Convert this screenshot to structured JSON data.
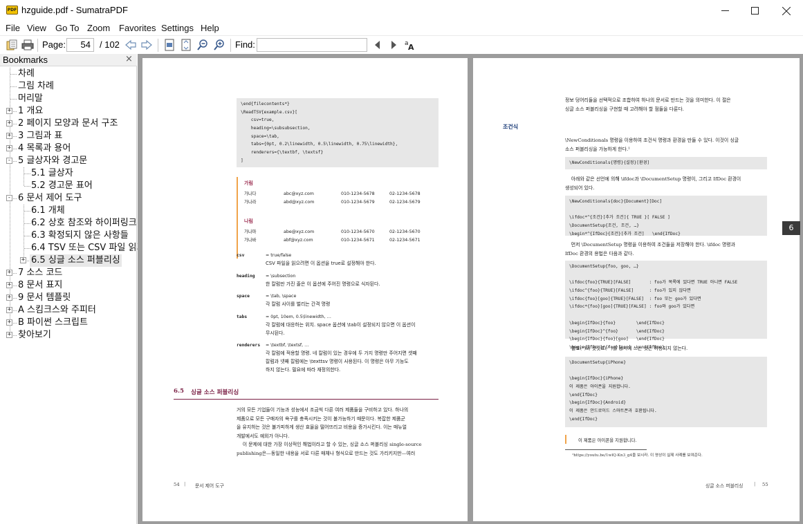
{
  "window": {
    "title": "hzguide.pdf - SumatraPDF",
    "app_icon_text": "PDF"
  },
  "menu": [
    "File",
    "View",
    "Go To",
    "Zoom",
    "Favorites",
    "Settings",
    "Help"
  ],
  "toolbar": {
    "page_label": "Page:",
    "page_value": "54",
    "page_total": "/ 102",
    "find_label": "Find:",
    "find_value": ""
  },
  "sidebar": {
    "title": "Bookmarks",
    "close": "×",
    "items": [
      {
        "label": "차례",
        "level": 0,
        "expander": ""
      },
      {
        "label": "그림 차례",
        "level": 0,
        "expander": ""
      },
      {
        "label": "머리말",
        "level": 0,
        "expander": ""
      },
      {
        "label": "1 개요",
        "level": 0,
        "expander": "+"
      },
      {
        "label": "2 페이지 모양과 문서 구조",
        "level": 0,
        "expander": "+"
      },
      {
        "label": "3 그림과 표",
        "level": 0,
        "expander": "+"
      },
      {
        "label": "4 목록과 용어",
        "level": 0,
        "expander": "+"
      },
      {
        "label": "5 글상자와 경고문",
        "level": 0,
        "expander": "-"
      },
      {
        "label": "5.1 글상자",
        "level": 1,
        "expander": ""
      },
      {
        "label": "5.2 경고문 표어",
        "level": 1,
        "expander": ""
      },
      {
        "label": "6 문서 제어 도구",
        "level": 0,
        "expander": "-"
      },
      {
        "label": "6.1 개체",
        "level": 1,
        "expander": ""
      },
      {
        "label": "6.2 상호 참조와 하이퍼링크",
        "level": 1,
        "expander": ""
      },
      {
        "label": "6.3 확정되지 않은 사항들",
        "level": 1,
        "expander": ""
      },
      {
        "label": "6.4 TSV 또는 CSV 파일 읽기",
        "level": 1,
        "expander": ""
      },
      {
        "label": "6.5 싱글 소스 퍼블리싱",
        "level": 1,
        "expander": "+"
      },
      {
        "label": "7 소스 코드",
        "level": 0,
        "expander": "+"
      },
      {
        "label": "8 문서 표지",
        "level": 0,
        "expander": "+"
      },
      {
        "label": "9 문서 템플릿",
        "level": 0,
        "expander": "+"
      },
      {
        "label": "A 스킴크스와 주피터",
        "level": 0,
        "expander": "+"
      },
      {
        "label": "B 파이썬 스크립트",
        "level": 0,
        "expander": "+"
      },
      {
        "label": "찾아보기",
        "level": 0,
        "expander": "+"
      }
    ]
  },
  "left_page": {
    "code1": [
      "\\end{filecontents*}",
      "\\ReadTSV{example.csv}[",
      "    csv=true,",
      "    heading=\\subsubsection,",
      "    space=\\tab,",
      "    tabs={0pt, 0.2\\linewidth, 0.5\\linewidth, 0.75\\linewidth},",
      "    renderers={\\textbf, \\textsf}",
      "]"
    ],
    "group1_title": "가림",
    "group1_rows": [
      [
        "가나다",
        "abc@xyz.com",
        "010-1234-5678",
        "02-1234-5678"
      ],
      [
        "가나라",
        "abd@xyz.com",
        "010-1234-5679",
        "02-1234-5679"
      ]
    ],
    "group2_title": "나림",
    "group2_rows": [
      [
        "가나마",
        "abe@xyz.com",
        "010-1234-5670",
        "02-1234-5670"
      ],
      [
        "가나바",
        "abf@xyz.com",
        "010-1234-5671",
        "02-1234-5671"
      ]
    ],
    "options": [
      {
        "key": "csv",
        "value": "= true/false",
        "desc": [
          "CSV 파일을 읽으려면 이 옵션을 true로 설정해야 한다."
        ]
      },
      {
        "key": "heading",
        "value": "= \\subsection",
        "desc": [
          "한 칼럼만 가진 줄은 이 옵션에 주어진 명령으로 식자된다."
        ]
      },
      {
        "key": "space",
        "value": "= \\tab, \\space",
        "desc": [
          "각 칼럼 사이를 벌리는 간격 명령"
        ]
      },
      {
        "key": "tabs",
        "value": "= 0pt, 10em, 0.5\\linewidth, …",
        "desc": [
          "각 칼럼에 대응하는 위치. space 옵션에 \\tab이 설정되지 않으면 이 옵션이",
          "무시된다."
        ]
      },
      {
        "key": "renderers",
        "value": "= \\textbf, \\textsf, …",
        "desc": [
          "각 칼럼에 적용할 명령. 네 칼럼이 있는 경우에 두 가지 명령만 주어지면 셋째",
          "칼럼과 넷째 칼럼에는 \\texttsv 명령이 사용된다. 이 명령은 아무 기능도",
          "하지 않는다. 필요에 따라 재정의한다."
        ]
      }
    ],
    "section_number": "6.5",
    "section_title": "싱글 소스 퍼블리싱",
    "body": [
      "거의 모든 기업들이 기능과 성능에서 조금씩 다른 여러 제품들을 구비하고 있다. 하나의",
      "제품으로 모든 구매자의 욕구를 충족시키는 것이 불가능하기 때문이다. 복잡한 제품군",
      "을 유지하는 것은 불가피하게 생산 효율을 떨어뜨리고 비용을 증가시킨다. 이는 매뉴얼",
      "개발에서도 예외가 아니다.",
      "    이 문제에 대한 가장 이상적인 해법이라고 할 수 있는, 싱글 소스 퍼블리싱 single-source",
      "publishing은—동일한 내용을 서로 다른 매체나 형식으로 만드는 것도 가리키지만—여러"
    ],
    "footer_num": "54",
    "footer_text": "문서 제어 도구"
  },
  "right_page": {
    "intro": [
      "정보 덩어리들을 선택적으로 조합하여 하나의 문서로 만드는 것을 의미한다. 이 절은",
      "싱글 소스 퍼블리싱을 구현할 때 고려해야 할 점들을 다룬다."
    ],
    "side_heading": "조건식",
    "para1": [
      "\\NewConditionals 명령을 이용하여 조건식 명령과 환경을 만들 수 있다. 이것이 싱글",
      "소스 퍼블리싱을 가능하게 한다.¹"
    ],
    "code1": [
      "\\NewConditionals{명령}{설정}[환경]"
    ],
    "para2": [
      "    아래와 같은 선언에 의해 \\ifdoc과 \\DocumentSetup 명령이, 그리고 IfDoc 환경이",
      "생성되어 있다."
    ],
    "code2": [
      "\\NewConditionals{doc}{Document}[Doc]",
      "",
      "\\ifdoc*^{조건}[추가 조건]{ TRUE }[ FALSE ]",
      "\\DocumentSetup{조건, 조건, …}",
      "\\begin*^{IfDoc}{조건}[추가 조건]   \\end{IfDoc}"
    ],
    "para3": [
      "    먼저 \\DocumentSetup 명령을 이용하여 조건들을 저장해야 한다. \\ifdoc 명령과",
      "IfDoc 환경의 용법은 다음과 같다."
    ],
    "code3": [
      "\\DocumentSetup{foo, goo, …}",
      "",
      "\\ifdoc{foo}{TRUE}[FALSE]       : foo가 목록에 있다면 TRUE 아니면 FALSE",
      "\\ifdoc^{foo}{TRUE}[FALSE]      : foo가 있지 않다면",
      "\\ifdoc{foo}[goo]{TRUE}[FALSE]  : foo 또는 goo가 있다면",
      "\\ifdoc*{foo}[goo]{TRUE}[FALSE] : foo와 goo가 있다면",
      "",
      "\\begin{IfDoc}{foo}        \\end{IfDoc}",
      "\\begin{IfDoc}^{foo}       \\end{IfDoc}",
      "\\begin{IfDoc}{foo}[goo]   \\end{IfDoc}",
      "\\begin{IfDoc}*{foo}[goo]  \\end{IfDoc}"
    ],
    "para4": [
      "    별표(*)와 삿갓표(^)를 동시에 쓰는 것은 허용되지 않는다."
    ],
    "code4": [
      "\\DocumentSetup{iPhone}",
      "",
      "\\begin{IfDoc}{iPhone}",
      "이 제품은 아이폰을 지원합니다.",
      "\\end{IfDoc}",
      "\\begin{IfDoc}{Android}",
      "이 제품은 안드로이드 스마트폰과 호환됩니다.",
      "\\end{IfDoc}"
    ],
    "result": "이 제품은 아이폰을 지원합니다.",
    "footnote": "¹https://youtu.be/1wlQ-Kn3_g4을 보시라. 이 영상이 실제 사례를 보여준다.",
    "footer_text": "싱글 소스 퍼블리싱",
    "footer_num": "55",
    "page_tab": "6"
  }
}
